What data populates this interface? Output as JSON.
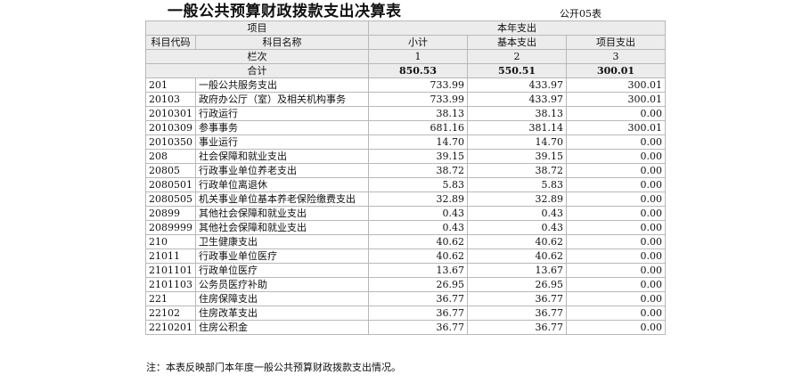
{
  "title": "一般公共预算财政拨款支出决算表",
  "form_code": "公开05表",
  "header": {
    "project": "项目",
    "current_year": "本年支出",
    "subject_code": "科目代码",
    "subject_name": "科目名称",
    "subtotal": "小计",
    "basic": "基本支出",
    "project_exp": "项目支出",
    "row_index_label": "栏次",
    "col1": "1",
    "col2": "2",
    "col3": "3"
  },
  "total": {
    "label": "合计",
    "subtotal": "850.53",
    "basic": "550.51",
    "project": "300.01"
  },
  "rows": [
    {
      "code": "201",
      "name": "一般公共服务支出",
      "subtotal": "733.99",
      "basic": "433.97",
      "project": "300.01"
    },
    {
      "code": "20103",
      "name": "政府办公厅（室）及相关机构事务",
      "subtotal": "733.99",
      "basic": "433.97",
      "project": "300.01"
    },
    {
      "code": "2010301",
      "name": "行政运行",
      "subtotal": "38.13",
      "basic": "38.13",
      "project": "0.00"
    },
    {
      "code": "2010309",
      "name": "参事事务",
      "subtotal": "681.16",
      "basic": "381.14",
      "project": "300.01"
    },
    {
      "code": "2010350",
      "name": "事业运行",
      "subtotal": "14.70",
      "basic": "14.70",
      "project": "0.00"
    },
    {
      "code": "208",
      "name": "社会保障和就业支出",
      "subtotal": "39.15",
      "basic": "39.15",
      "project": "0.00"
    },
    {
      "code": "20805",
      "name": "行政事业单位养老支出",
      "subtotal": "38.72",
      "basic": "38.72",
      "project": "0.00"
    },
    {
      "code": "2080501",
      "name": "行政单位离退休",
      "subtotal": "5.83",
      "basic": "5.83",
      "project": "0.00"
    },
    {
      "code": "2080505",
      "name": "机关事业单位基本养老保险缴费支出",
      "subtotal": "32.89",
      "basic": "32.89",
      "project": "0.00"
    },
    {
      "code": "20899",
      "name": "其他社会保障和就业支出",
      "subtotal": "0.43",
      "basic": "0.43",
      "project": "0.00"
    },
    {
      "code": "2089999",
      "name": "其他社会保障和就业支出",
      "subtotal": "0.43",
      "basic": "0.43",
      "project": "0.00"
    },
    {
      "code": "210",
      "name": "卫生健康支出",
      "subtotal": "40.62",
      "basic": "40.62",
      "project": "0.00"
    },
    {
      "code": "21011",
      "name": "行政事业单位医疗",
      "subtotal": "40.62",
      "basic": "40.62",
      "project": "0.00"
    },
    {
      "code": "2101101",
      "name": "行政单位医疗",
      "subtotal": "13.67",
      "basic": "13.67",
      "project": "0.00"
    },
    {
      "code": "2101103",
      "name": "公务员医疗补助",
      "subtotal": "26.95",
      "basic": "26.95",
      "project": "0.00"
    },
    {
      "code": "221",
      "name": "住房保障支出",
      "subtotal": "36.77",
      "basic": "36.77",
      "project": "0.00"
    },
    {
      "code": "22102",
      "name": "住房改革支出",
      "subtotal": "36.77",
      "basic": "36.77",
      "project": "0.00"
    },
    {
      "code": "2210201",
      "name": "住房公积金",
      "subtotal": "36.77",
      "basic": "36.77",
      "project": "0.00"
    }
  ],
  "note": "注：本表反映部门本年度一般公共预算财政拨款支出情况。"
}
